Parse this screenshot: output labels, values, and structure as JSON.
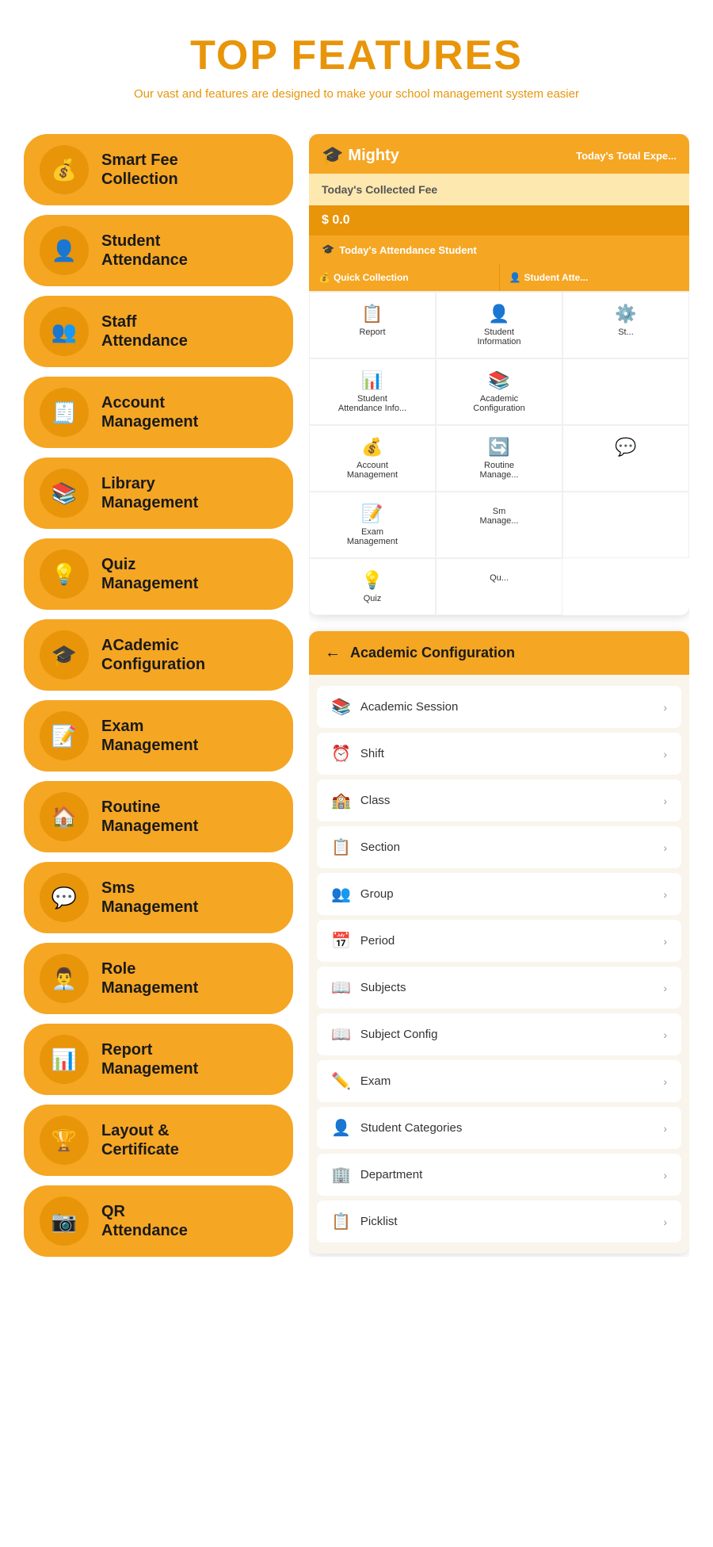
{
  "header": {
    "title": "TOP FEATURES",
    "subtitle": "Our vast and features are designed to make your school management system easier"
  },
  "features": [
    {
      "id": "smart-fee",
      "label": "Smart Fee\nCollection",
      "icon": "💰"
    },
    {
      "id": "student-attendance",
      "label": "Student\nAttendance",
      "icon": "👤"
    },
    {
      "id": "staff-attendance",
      "label": "Staff\nAttendance",
      "icon": "👥"
    },
    {
      "id": "account-management",
      "label": "Account\nManagement",
      "icon": "🧾"
    },
    {
      "id": "library-management",
      "label": "Library\nManagement",
      "icon": "📚"
    },
    {
      "id": "quiz-management",
      "label": "Quiz\nManagement",
      "icon": "💡"
    },
    {
      "id": "academic-config",
      "label": "ACademic\nConfiguration",
      "icon": "🎓"
    },
    {
      "id": "exam-management",
      "label": "Exam\nManagement",
      "icon": "📝"
    },
    {
      "id": "routine-management",
      "label": "Routine\nManagement",
      "icon": "🏠"
    },
    {
      "id": "sms-management",
      "label": "Sms\nManagement",
      "icon": "💬"
    },
    {
      "id": "role-management",
      "label": "Role\nManagement",
      "icon": "👨‍💼"
    },
    {
      "id": "report-management",
      "label": "Report\nManagement",
      "icon": "📊"
    },
    {
      "id": "layout-certificate",
      "label": "Layout &\nCertificate",
      "icon": "🏆"
    },
    {
      "id": "qr-attendance",
      "label": "QR\nAttendance",
      "icon": "📷"
    }
  ],
  "app_mockup": {
    "logo": "Mighty",
    "logo_icon": "🎓",
    "header_right": "Today's Total Expe...",
    "collected_fee_label": "Today's Collected Fee",
    "fee_amount": "$ 0.0",
    "attendance_label": "Today's Attendance Student",
    "quick_collection": "Quick Collection",
    "student_attendance_btn": "Student Atte...",
    "grid_items": [
      {
        "label": "Report",
        "icon": "📋"
      },
      {
        "label": "Student\nInformation",
        "icon": "👤"
      },
      {
        "label": "St...",
        "icon": "⚙️"
      },
      {
        "label": "Student\nAttendance Info...",
        "icon": "📊"
      },
      {
        "label": "Academic\nConfiguration",
        "icon": "📚"
      },
      {
        "label": "",
        "icon": ""
      },
      {
        "label": "Account\nManagement",
        "icon": "💰"
      },
      {
        "label": "Routine\nManageme...",
        "icon": "🔄"
      },
      {
        "label": "",
        "icon": "💬"
      },
      {
        "label": "Exam\nManagement",
        "icon": "📝"
      },
      {
        "label": "Sm\nManage...",
        "icon": ""
      },
      {
        "label": "",
        "icon": ""
      },
      {
        "label": "Quiz",
        "icon": "💡"
      },
      {
        "label": "Qu...",
        "icon": ""
      }
    ]
  },
  "academic_panel": {
    "title": "Academic Configuration",
    "back_label": "←",
    "items": [
      {
        "label": "Academic Session",
        "icon": "📚"
      },
      {
        "label": "Shift",
        "icon": "⏰"
      },
      {
        "label": "Class",
        "icon": "🏫"
      },
      {
        "label": "Section",
        "icon": "📋"
      },
      {
        "label": "Group",
        "icon": "👥"
      },
      {
        "label": "Period",
        "icon": "📅"
      },
      {
        "label": "Subjects",
        "icon": "📖"
      },
      {
        "label": "Subject Config",
        "icon": "📖"
      },
      {
        "label": "Exam",
        "icon": "✏️"
      },
      {
        "label": "Student Categories",
        "icon": "👤"
      },
      {
        "label": "Department",
        "icon": "🏢"
      },
      {
        "label": "Picklist",
        "icon": "📋"
      }
    ]
  }
}
